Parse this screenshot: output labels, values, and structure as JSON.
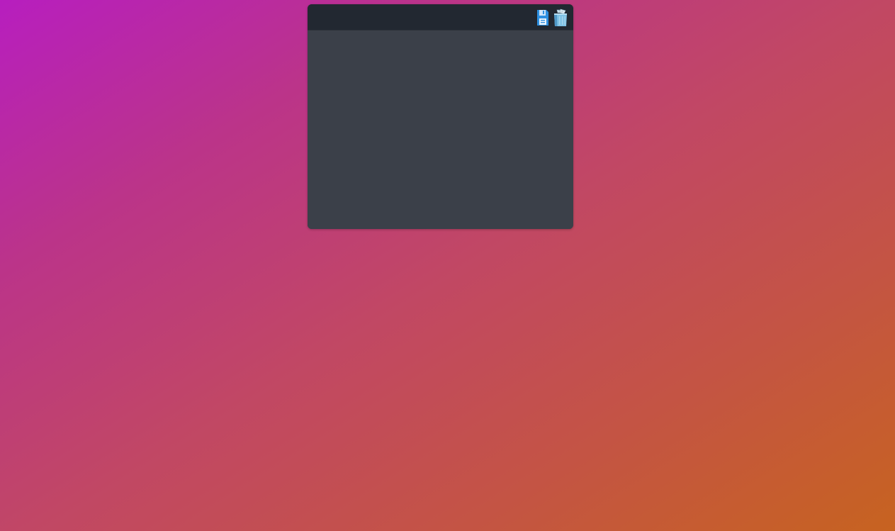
{
  "panel": {
    "toolbar": {
      "save_icon": "floppy-disk-save-icon",
      "trash_icon": "recycle-bin-trash-icon"
    },
    "content": ""
  },
  "colors": {
    "panel_header": "#222831",
    "panel_body": "#3b4049",
    "save_icon_blue": "#2d8fe0",
    "trash_icon_blue": "#7fc3e6",
    "background_gradient_start": "#b71ebf",
    "background_gradient_end": "#c76320"
  }
}
